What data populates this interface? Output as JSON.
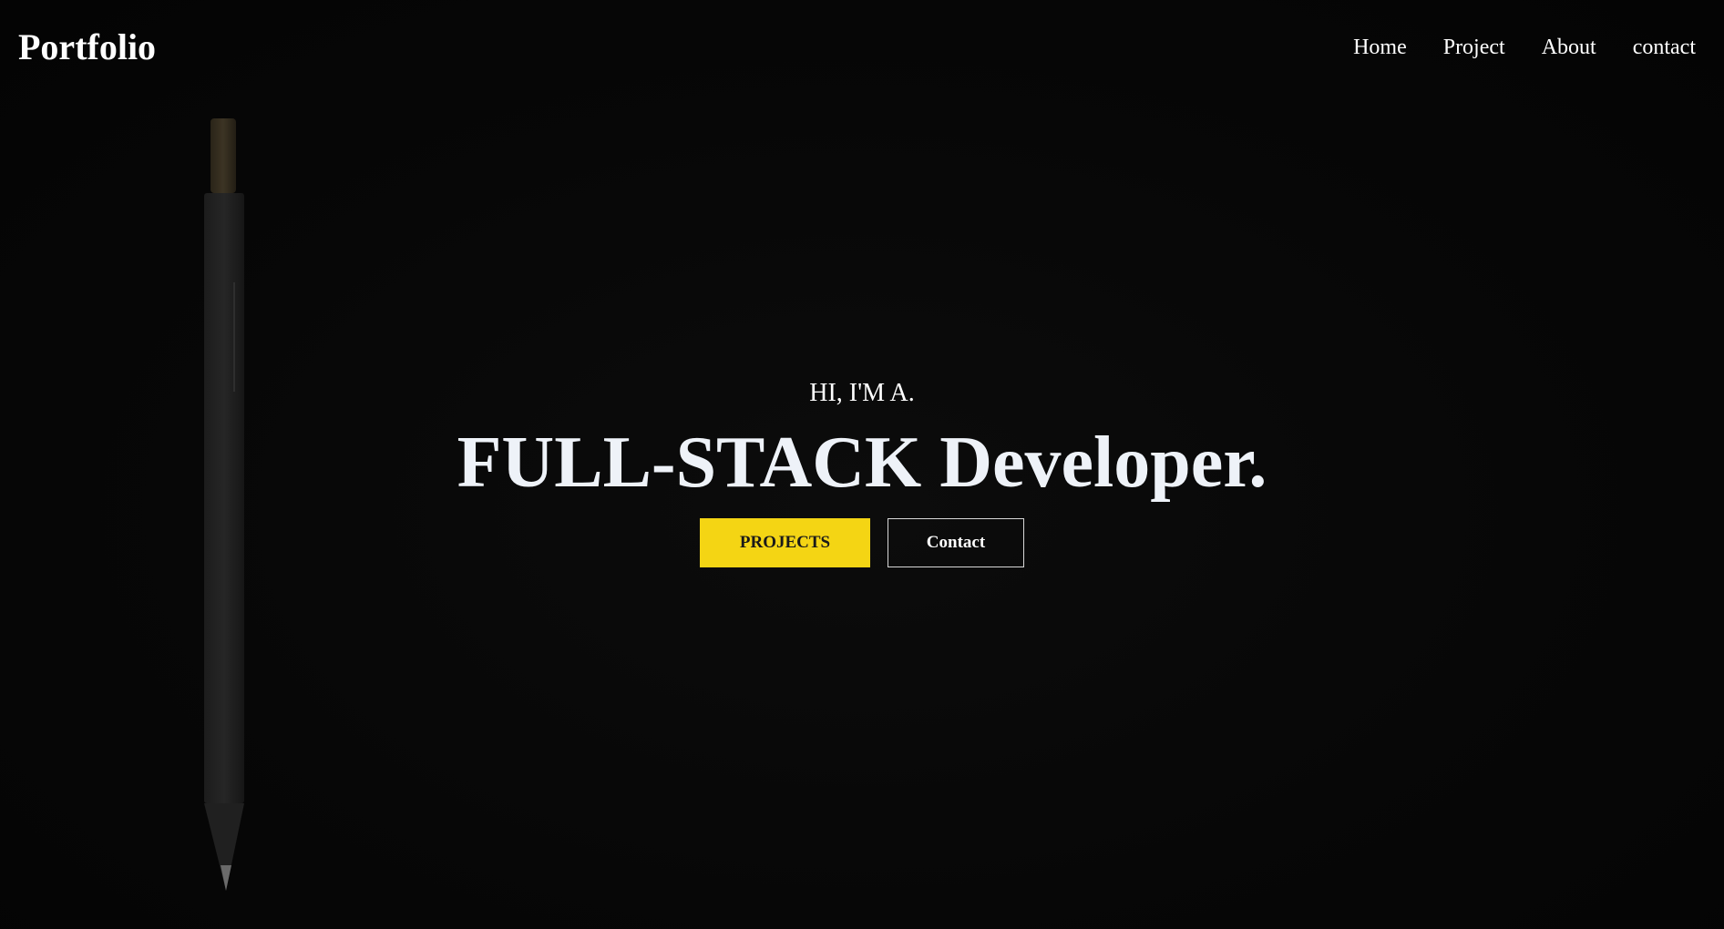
{
  "nav": {
    "logo": "Portfolio",
    "links": [
      "Home",
      "Project",
      "About",
      "contact"
    ]
  },
  "hero": {
    "intro": "HI, I'M A.",
    "title": "FULL-STACK Developer.",
    "buttons": {
      "projects": "PROJECTS",
      "contact": "Contact"
    }
  },
  "colors": {
    "background": "#060606",
    "accent": "#f4d514",
    "text": "#ffffff"
  },
  "icons": {
    "background_image": "pencil"
  }
}
